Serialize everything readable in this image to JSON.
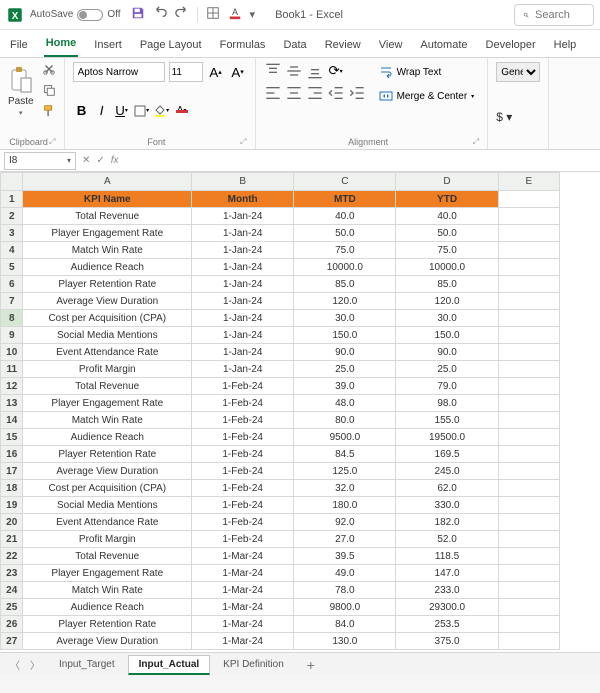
{
  "titlebar": {
    "autosave_label": "AutoSave",
    "autosave_state": "Off",
    "doc_title": "Book1 - Excel",
    "search_placeholder": "Search"
  },
  "ribbon_tabs": [
    "File",
    "Home",
    "Insert",
    "Page Layout",
    "Formulas",
    "Data",
    "Review",
    "View",
    "Automate",
    "Developer",
    "Help"
  ],
  "ribbon_active": "Home",
  "ribbon": {
    "paste_label": "Paste",
    "clipboard_group": "Clipboard",
    "font_name": "Aptos Narrow",
    "font_size": "11",
    "font_group": "Font",
    "align_group": "Alignment",
    "wrap_label": "Wrap Text",
    "merge_label": "Merge & Center",
    "number_format": "General"
  },
  "fx": {
    "name_box": "I8",
    "formula": ""
  },
  "columns": [
    "A",
    "B",
    "C",
    "D",
    "E"
  ],
  "headers": {
    "A": "KPI Name",
    "B": "Month",
    "C": "MTD",
    "D": "YTD"
  },
  "rows": [
    {
      "r": 2,
      "a": "Total Revenue",
      "b": "1-Jan-24",
      "c": "40.0",
      "d": "40.0"
    },
    {
      "r": 3,
      "a": "Player Engagement Rate",
      "b": "1-Jan-24",
      "c": "50.0",
      "d": "50.0"
    },
    {
      "r": 4,
      "a": "Match Win Rate",
      "b": "1-Jan-24",
      "c": "75.0",
      "d": "75.0"
    },
    {
      "r": 5,
      "a": "Audience Reach",
      "b": "1-Jan-24",
      "c": "10000.0",
      "d": "10000.0"
    },
    {
      "r": 6,
      "a": "Player Retention Rate",
      "b": "1-Jan-24",
      "c": "85.0",
      "d": "85.0"
    },
    {
      "r": 7,
      "a": "Average View Duration",
      "b": "1-Jan-24",
      "c": "120.0",
      "d": "120.0"
    },
    {
      "r": 8,
      "a": "Cost per Acquisition (CPA)",
      "b": "1-Jan-24",
      "c": "30.0",
      "d": "30.0"
    },
    {
      "r": 9,
      "a": "Social Media Mentions",
      "b": "1-Jan-24",
      "c": "150.0",
      "d": "150.0"
    },
    {
      "r": 10,
      "a": "Event Attendance Rate",
      "b": "1-Jan-24",
      "c": "90.0",
      "d": "90.0"
    },
    {
      "r": 11,
      "a": "Profit Margin",
      "b": "1-Jan-24",
      "c": "25.0",
      "d": "25.0"
    },
    {
      "r": 12,
      "a": "Total Revenue",
      "b": "1-Feb-24",
      "c": "39.0",
      "d": "79.0"
    },
    {
      "r": 13,
      "a": "Player Engagement Rate",
      "b": "1-Feb-24",
      "c": "48.0",
      "d": "98.0"
    },
    {
      "r": 14,
      "a": "Match Win Rate",
      "b": "1-Feb-24",
      "c": "80.0",
      "d": "155.0"
    },
    {
      "r": 15,
      "a": "Audience Reach",
      "b": "1-Feb-24",
      "c": "9500.0",
      "d": "19500.0"
    },
    {
      "r": 16,
      "a": "Player Retention Rate",
      "b": "1-Feb-24",
      "c": "84.5",
      "d": "169.5"
    },
    {
      "r": 17,
      "a": "Average View Duration",
      "b": "1-Feb-24",
      "c": "125.0",
      "d": "245.0"
    },
    {
      "r": 18,
      "a": "Cost per Acquisition (CPA)",
      "b": "1-Feb-24",
      "c": "32.0",
      "d": "62.0"
    },
    {
      "r": 19,
      "a": "Social Media Mentions",
      "b": "1-Feb-24",
      "c": "180.0",
      "d": "330.0"
    },
    {
      "r": 20,
      "a": "Event Attendance Rate",
      "b": "1-Feb-24",
      "c": "92.0",
      "d": "182.0"
    },
    {
      "r": 21,
      "a": "Profit Margin",
      "b": "1-Feb-24",
      "c": "27.0",
      "d": "52.0"
    },
    {
      "r": 22,
      "a": "Total Revenue",
      "b": "1-Mar-24",
      "c": "39.5",
      "d": "118.5"
    },
    {
      "r": 23,
      "a": "Player Engagement Rate",
      "b": "1-Mar-24",
      "c": "49.0",
      "d": "147.0"
    },
    {
      "r": 24,
      "a": "Match Win Rate",
      "b": "1-Mar-24",
      "c": "78.0",
      "d": "233.0"
    },
    {
      "r": 25,
      "a": "Audience Reach",
      "b": "1-Mar-24",
      "c": "9800.0",
      "d": "29300.0"
    },
    {
      "r": 26,
      "a": "Player Retention Rate",
      "b": "1-Mar-24",
      "c": "84.0",
      "d": "253.5"
    },
    {
      "r": 27,
      "a": "Average View Duration",
      "b": "1-Mar-24",
      "c": "130.0",
      "d": "375.0"
    }
  ],
  "sheet_tabs": [
    "Input_Target",
    "Input_Actual",
    "KPI Definition"
  ],
  "active_sheet": "Input_Actual",
  "selected_row": 8,
  "chart_data": {
    "type": "table",
    "title": "Input_Actual",
    "columns": [
      "KPI Name",
      "Month",
      "MTD",
      "YTD"
    ],
    "series": [
      {
        "name": "Total Revenue",
        "month": "1-Jan-24",
        "mtd": 40.0,
        "ytd": 40.0
      },
      {
        "name": "Player Engagement Rate",
        "month": "1-Jan-24",
        "mtd": 50.0,
        "ytd": 50.0
      },
      {
        "name": "Match Win Rate",
        "month": "1-Jan-24",
        "mtd": 75.0,
        "ytd": 75.0
      },
      {
        "name": "Audience Reach",
        "month": "1-Jan-24",
        "mtd": 10000.0,
        "ytd": 10000.0
      },
      {
        "name": "Player Retention Rate",
        "month": "1-Jan-24",
        "mtd": 85.0,
        "ytd": 85.0
      },
      {
        "name": "Average View Duration",
        "month": "1-Jan-24",
        "mtd": 120.0,
        "ytd": 120.0
      },
      {
        "name": "Cost per Acquisition (CPA)",
        "month": "1-Jan-24",
        "mtd": 30.0,
        "ytd": 30.0
      },
      {
        "name": "Social Media Mentions",
        "month": "1-Jan-24",
        "mtd": 150.0,
        "ytd": 150.0
      },
      {
        "name": "Event Attendance Rate",
        "month": "1-Jan-24",
        "mtd": 90.0,
        "ytd": 90.0
      },
      {
        "name": "Profit Margin",
        "month": "1-Jan-24",
        "mtd": 25.0,
        "ytd": 25.0
      },
      {
        "name": "Total Revenue",
        "month": "1-Feb-24",
        "mtd": 39.0,
        "ytd": 79.0
      },
      {
        "name": "Player Engagement Rate",
        "month": "1-Feb-24",
        "mtd": 48.0,
        "ytd": 98.0
      },
      {
        "name": "Match Win Rate",
        "month": "1-Feb-24",
        "mtd": 80.0,
        "ytd": 155.0
      },
      {
        "name": "Audience Reach",
        "month": "1-Feb-24",
        "mtd": 9500.0,
        "ytd": 19500.0
      },
      {
        "name": "Player Retention Rate",
        "month": "1-Feb-24",
        "mtd": 84.5,
        "ytd": 169.5
      },
      {
        "name": "Average View Duration",
        "month": "1-Feb-24",
        "mtd": 125.0,
        "ytd": 245.0
      },
      {
        "name": "Cost per Acquisition (CPA)",
        "month": "1-Feb-24",
        "mtd": 32.0,
        "ytd": 62.0
      },
      {
        "name": "Social Media Mentions",
        "month": "1-Feb-24",
        "mtd": 180.0,
        "ytd": 330.0
      },
      {
        "name": "Event Attendance Rate",
        "month": "1-Feb-24",
        "mtd": 92.0,
        "ytd": 182.0
      },
      {
        "name": "Profit Margin",
        "month": "1-Feb-24",
        "mtd": 27.0,
        "ytd": 52.0
      },
      {
        "name": "Total Revenue",
        "month": "1-Mar-24",
        "mtd": 39.5,
        "ytd": 118.5
      },
      {
        "name": "Player Engagement Rate",
        "month": "1-Mar-24",
        "mtd": 49.0,
        "ytd": 147.0
      },
      {
        "name": "Match Win Rate",
        "month": "1-Mar-24",
        "mtd": 78.0,
        "ytd": 233.0
      },
      {
        "name": "Audience Reach",
        "month": "1-Mar-24",
        "mtd": 9800.0,
        "ytd": 29300.0
      },
      {
        "name": "Player Retention Rate",
        "month": "1-Mar-24",
        "mtd": 84.0,
        "ytd": 253.5
      },
      {
        "name": "Average View Duration",
        "month": "1-Mar-24",
        "mtd": 130.0,
        "ytd": 375.0
      }
    ]
  }
}
